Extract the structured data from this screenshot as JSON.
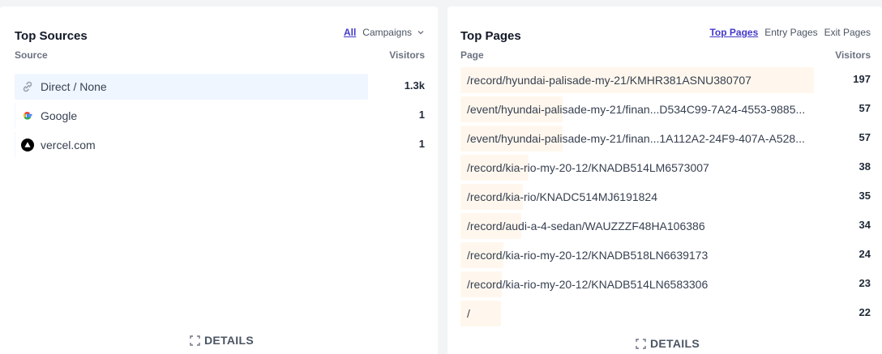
{
  "sources": {
    "title": "Top Sources",
    "tabs": {
      "all": "All",
      "campaigns": "Campaigns"
    },
    "col_source": "Source",
    "col_visitors": "Visitors",
    "rows": [
      {
        "label": "Direct / None",
        "value": "1.3k",
        "icon": "link-icon"
      },
      {
        "label": "Google",
        "value": "1",
        "icon": "google-icon"
      },
      {
        "label": "vercel.com",
        "value": "1",
        "icon": "vercel-icon"
      }
    ],
    "details": "DETAILS"
  },
  "pages": {
    "title": "Top Pages",
    "tabs": {
      "top": "Top Pages",
      "entry": "Entry Pages",
      "exit": "Exit Pages"
    },
    "col_page": "Page",
    "col_visitors": "Visitors",
    "rows": [
      {
        "label": "/record/hyundai-palisade-my-21/KMHR381ASNU380707",
        "value": "197"
      },
      {
        "label": "/event/hyundai-palisade-my-21/finan...D534C99-7A24-4553-9885...",
        "value": "57"
      },
      {
        "label": "/event/hyundai-palisade-my-21/finan...1A112A2-24F9-407A-A528...",
        "value": "57"
      },
      {
        "label": "/record/kia-rio-my-20-12/KNADB514LM6573007",
        "value": "38"
      },
      {
        "label": "/record/kia-rio/KNADC514MJ6191824",
        "value": "35"
      },
      {
        "label": "/record/audi-a-4-sedan/WAUZZZF48HA106386",
        "value": "34"
      },
      {
        "label": "/record/kia-rio-my-20-12/KNADB518LN6639173",
        "value": "24"
      },
      {
        "label": "/record/kia-rio-my-20-12/KNADB514LN6583306",
        "value": "23"
      },
      {
        "label": "/",
        "value": "22"
      }
    ],
    "details": "DETAILS"
  },
  "colors": {
    "source_bar": "#eff6ff",
    "page_bar": "#fff7ed",
    "accent": "#4338ca"
  }
}
